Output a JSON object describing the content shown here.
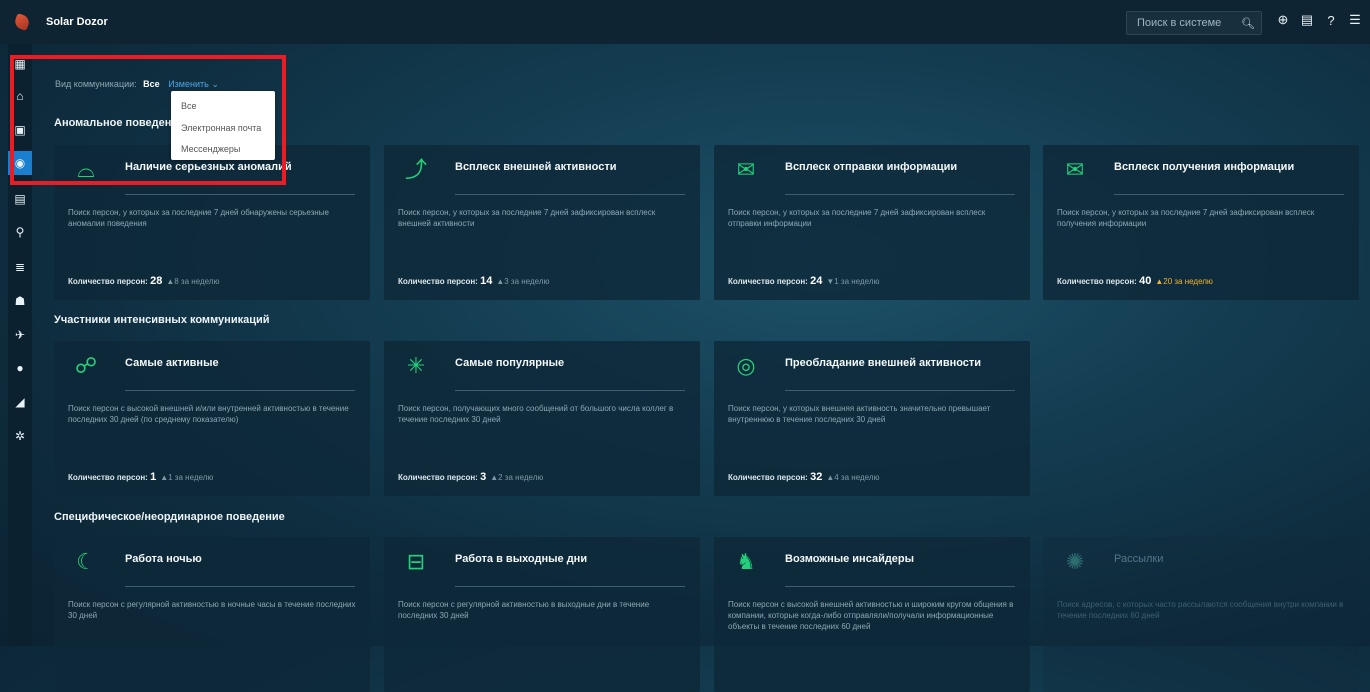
{
  "app": {
    "title": "Solar Dozor"
  },
  "search": {
    "placeholder": "Поиск в системе"
  },
  "filter": {
    "label": "Вид коммуникации:",
    "current": "Все",
    "change": "Изменить",
    "options": [
      "Все",
      "Электронная почта",
      "Мессенджеры"
    ]
  },
  "sections": [
    {
      "title": "Аномальное поведение",
      "cards": [
        {
          "title": "Наличие серьезных аномалий",
          "desc": "Поиск персон, у которых за последние 7 дней обнаружены серьезные аномалии поведения",
          "count_label": "Количество персон:",
          "count": "28",
          "trend": "▲8 за неделю",
          "icon": "ufo-icon"
        },
        {
          "title": "Всплеск внешней активности",
          "desc": "Поиск персон, у которых за последние 7 дней зафиксирован всплеск внешней активности",
          "count_label": "Количество персон:",
          "count": "14",
          "trend": "▲3 за неделю",
          "icon": "chart-spike-icon"
        },
        {
          "title": "Всплеск отправки информации",
          "desc": "Поиск персон, у которых за последние 7 дней зафиксирован всплеск отправки информации",
          "count_label": "Количество персон:",
          "count": "24",
          "trend": "▼1 за неделю",
          "icon": "mail-send-icon"
        },
        {
          "title": "Всплеск получения информации",
          "desc": "Поиск персон, у которых за последние 7 дней зафиксирован всплеск получения информации",
          "count_label": "Количество персон:",
          "count": "40",
          "trend": "▲20 за неделю",
          "icon": "mail-receive-icon"
        }
      ]
    },
    {
      "title": "Участники интенсивных коммуникаций",
      "cards": [
        {
          "title": "Самые активные",
          "desc": "Поиск персон с высокой внешней и/или внутренней активностью в течение последних 30 дней (по среднему показателю)",
          "count_label": "Количество персон:",
          "count": "1",
          "trend": "▲1 за неделю",
          "icon": "runner-icon"
        },
        {
          "title": "Самые популярные",
          "desc": "Поиск персон, получающих много сообщений от большого числа коллег в течение последних 30 дней",
          "count_label": "Количество персон:",
          "count": "3",
          "trend": "▲2 за неделю",
          "icon": "popular-icon"
        },
        {
          "title": "Преобладание внешней активности",
          "desc": "Поиск персон, у которых внешняя активность значительно превышает внутреннюю в течение последних 30 дней",
          "count_label": "Количество персон:",
          "count": "32",
          "trend": "▲4 за неделю",
          "icon": "envelope-circle-icon"
        }
      ]
    },
    {
      "title": "Специфическое/неординарное поведение",
      "cards": [
        {
          "title": "Работа ночью",
          "desc": "Поиск персон с регулярной активностью в ночные часы в течение последних 30 дней",
          "icon": "moon-icon"
        },
        {
          "title": "Работа в выходные дни",
          "desc": "Поиск персон с регулярной активностью в выходные дни в течение последних 30 дней",
          "icon": "sofa-icon"
        },
        {
          "title": "Возможные инсайдеры",
          "desc": "Поиск персон с высокой внешней активностью и широким кругом общения в компании, которые когда-либо отправляли/получали информационные объекты в течение последних 60 дней",
          "icon": "trojan-horse-icon"
        },
        {
          "title": "Рассылки",
          "desc": "Поиск адресов, с которых часто рассылаются сообщения внутри компании в течение последних 60 дней",
          "icon": "broadcast-icon"
        }
      ]
    }
  ]
}
